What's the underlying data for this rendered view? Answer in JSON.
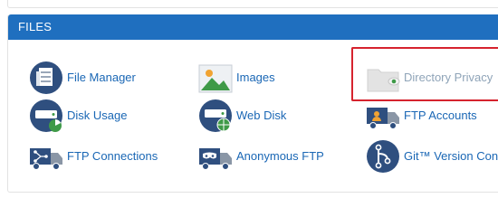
{
  "section": {
    "title": "FILES"
  },
  "items": [
    {
      "label": "File Manager",
      "icon": "file-manager-icon"
    },
    {
      "label": "Images",
      "icon": "images-icon"
    },
    {
      "label": "Directory Privacy",
      "icon": "directory-privacy-icon"
    },
    {
      "label": "Disk Usage",
      "icon": "disk-usage-icon"
    },
    {
      "label": "Web Disk",
      "icon": "web-disk-icon"
    },
    {
      "label": "FTP Accounts",
      "icon": "ftp-accounts-icon"
    },
    {
      "label": "FTP Connections",
      "icon": "ftp-connections-icon"
    },
    {
      "label": "Anonymous FTP",
      "icon": "anonymous-ftp-icon"
    },
    {
      "label": "Git™ Version Control",
      "icon": "git-version-control-icon"
    }
  ],
  "colors": {
    "header": "#1f6fbf",
    "link": "#1a67b5",
    "highlight": "#d6232e"
  }
}
